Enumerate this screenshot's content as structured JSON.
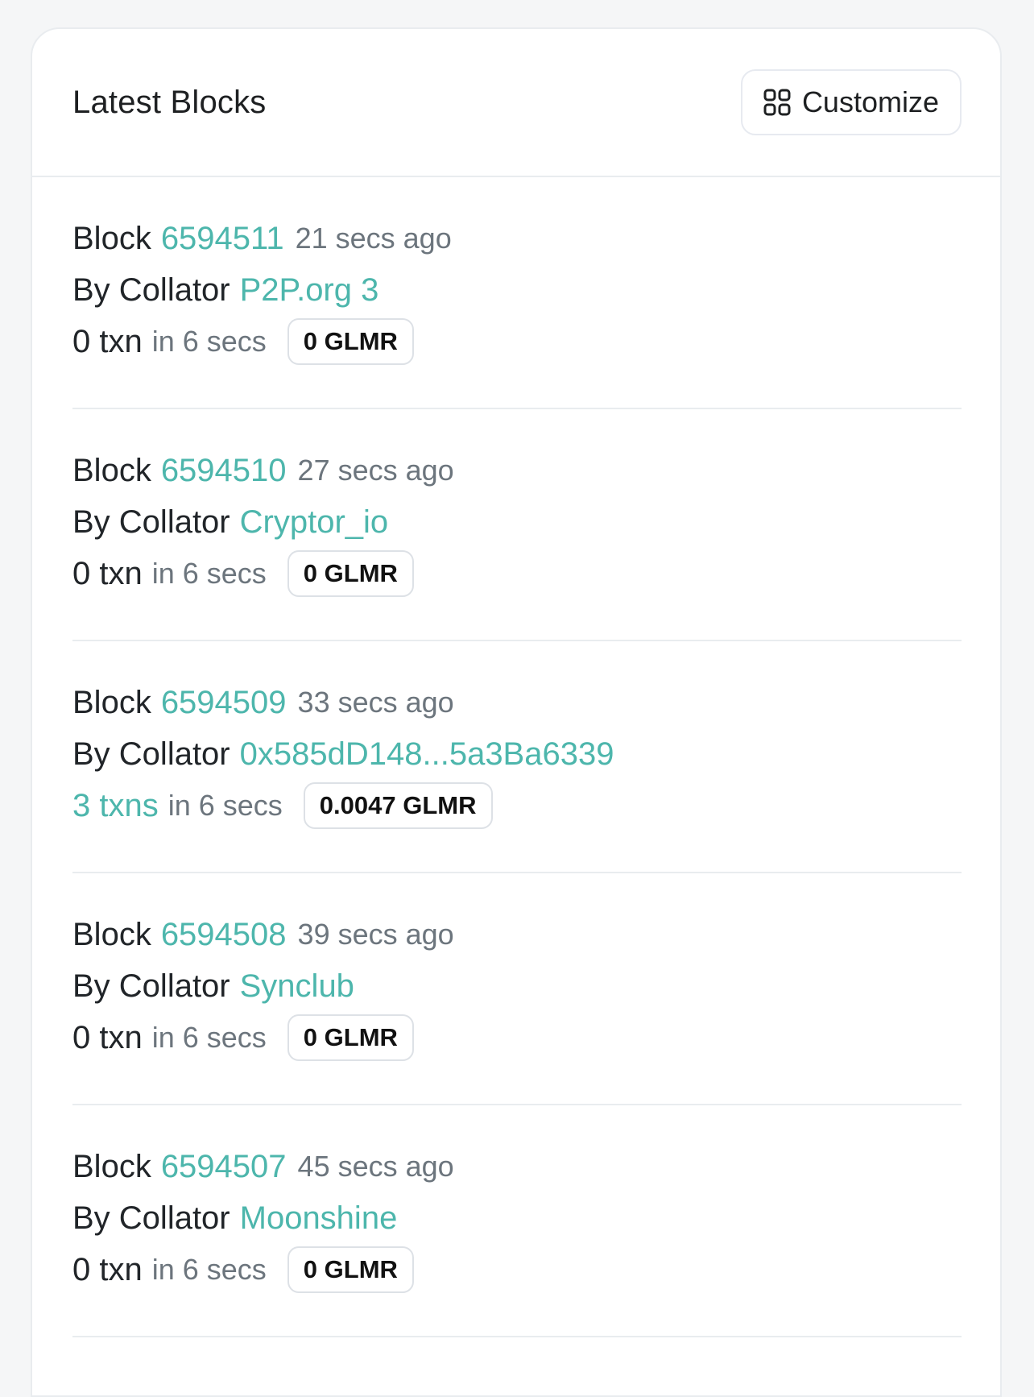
{
  "header": {
    "title": "Latest Blocks",
    "customize_label": "Customize",
    "customize_icon": "grid-icon"
  },
  "colors": {
    "accent": "#4db6ac",
    "text": "#212529",
    "muted": "#6c757d",
    "border": "#e9ecef"
  },
  "blocks": [
    {
      "block_label": "Block",
      "number": "6594511",
      "age": "21 secs ago",
      "collator_label": "By Collator",
      "collator": "P2P.org 3",
      "txn": "0 txn",
      "txn_is_link": false,
      "duration": "in 6 secs",
      "reward": "0 GLMR"
    },
    {
      "block_label": "Block",
      "number": "6594510",
      "age": "27 secs ago",
      "collator_label": "By Collator",
      "collator": "Cryptor_io",
      "txn": "0 txn",
      "txn_is_link": false,
      "duration": "in 6 secs",
      "reward": "0 GLMR"
    },
    {
      "block_label": "Block",
      "number": "6594509",
      "age": "33 secs ago",
      "collator_label": "By Collator",
      "collator": "0x585dD148...5a3Ba6339",
      "txn": "3 txns",
      "txn_is_link": true,
      "duration": "in 6 secs",
      "reward": "0.0047 GLMR"
    },
    {
      "block_label": "Block",
      "number": "6594508",
      "age": "39 secs ago",
      "collator_label": "By Collator",
      "collator": "Synclub",
      "txn": "0 txn",
      "txn_is_link": false,
      "duration": "in 6 secs",
      "reward": "0 GLMR"
    },
    {
      "block_label": "Block",
      "number": "6594507",
      "age": "45 secs ago",
      "collator_label": "By Collator",
      "collator": "Moonshine",
      "txn": "0 txn",
      "txn_is_link": false,
      "duration": "in 6 secs",
      "reward": "0 GLMR"
    }
  ]
}
